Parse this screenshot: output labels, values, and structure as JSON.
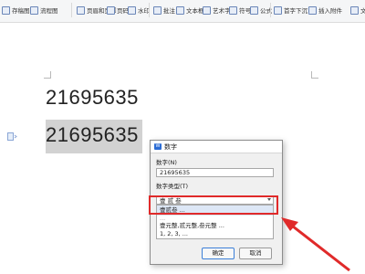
{
  "toolbar": {
    "items": [
      "存稿图表",
      "流程图",
      "页眉和页脚",
      "页码",
      "水印",
      "批注",
      "文本框",
      "艺术字",
      "符号",
      "公式",
      "首字下沉",
      "插入附件",
      "文"
    ]
  },
  "document": {
    "line1": "21695635",
    "line2": "21695635"
  },
  "dialog": {
    "title": "数字",
    "number_label": "数字(N)",
    "number_value": "21695635",
    "type_label": "数字类型(T)",
    "type_selected": "壹 贰 叁",
    "list_items": [
      "壹贰叁 ...",
      "...",
      "壹元整,贰元整,叁元整 ...",
      "1, 2, 3, ..."
    ],
    "ok": "确定",
    "cancel": "取消"
  },
  "colors": {
    "annotation": "#e02a2a",
    "selection": "#d2d2d2"
  }
}
